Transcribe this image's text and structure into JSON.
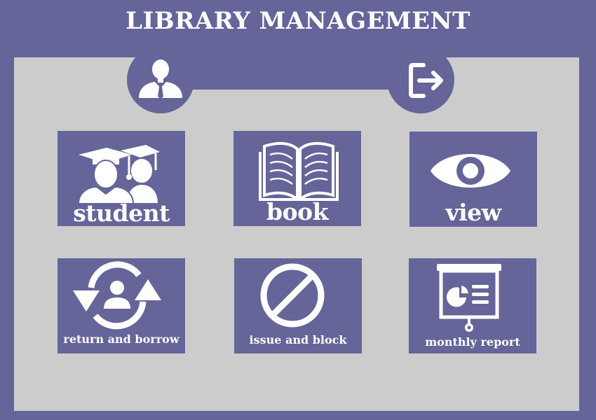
{
  "app": {
    "title": "LIBRARY MANAGEMENT"
  },
  "header": {
    "profile_icon": "user-profile-icon",
    "logout_icon": "logout-icon"
  },
  "tiles": [
    {
      "label": "student",
      "icon": "graduates-icon"
    },
    {
      "label": "book",
      "icon": "open-book-icon"
    },
    {
      "label": "view",
      "icon": "eye-icon"
    },
    {
      "label": "return and borrow",
      "icon": "user-sync-icon"
    },
    {
      "label": "issue and block",
      "icon": "block-icon"
    },
    {
      "label": "monthly report",
      "icon": "presentation-board-icon"
    }
  ],
  "colors": {
    "background": "#65659a",
    "panel": "#cccccc",
    "text": "#ffffff"
  }
}
